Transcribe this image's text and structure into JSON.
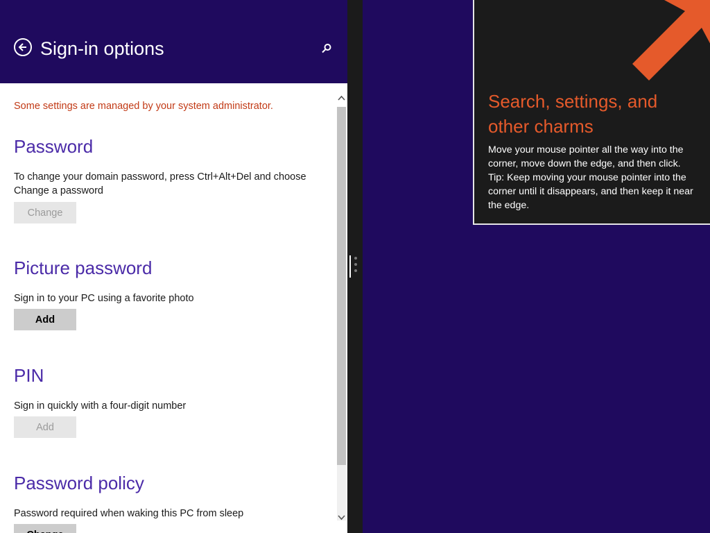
{
  "header": {
    "title": "Sign-in options",
    "back_icon": "back-arrow-circle-icon",
    "search_icon": "search-icon",
    "bg_color": "#1f0a5e"
  },
  "notice": "Some settings are managed by your system administrator.",
  "sections": {
    "password": {
      "title": "Password",
      "desc": "To change your domain password, press Ctrl+Alt+Del and choose Change a password",
      "button": "Change",
      "button_enabled": false
    },
    "picture_password": {
      "title": "Picture password",
      "desc": "Sign in to your PC using a favorite photo",
      "button": "Add",
      "button_enabled": true
    },
    "pin": {
      "title": "PIN",
      "desc": "Sign in quickly with a four-digit number",
      "button": "Add",
      "button_enabled": false
    },
    "password_policy": {
      "title": "Password policy",
      "desc": "Password required when waking this PC from sleep",
      "button": "Change",
      "button_enabled": true
    }
  },
  "tip": {
    "title": "Search, settings, and other charms",
    "body": "Move your mouse pointer all the way into the corner, move down the edge, and then click. Tip: Keep moving your mouse pointer into the corner until it disappears, and then keep it near the edge.",
    "arrow_icon": "corner-arrow-icon",
    "accent_color": "#e55a2b"
  },
  "colors": {
    "section_title": "#4b2ba8",
    "notice": "#c23a16",
    "desktop_bg": "#1f0a5e"
  }
}
